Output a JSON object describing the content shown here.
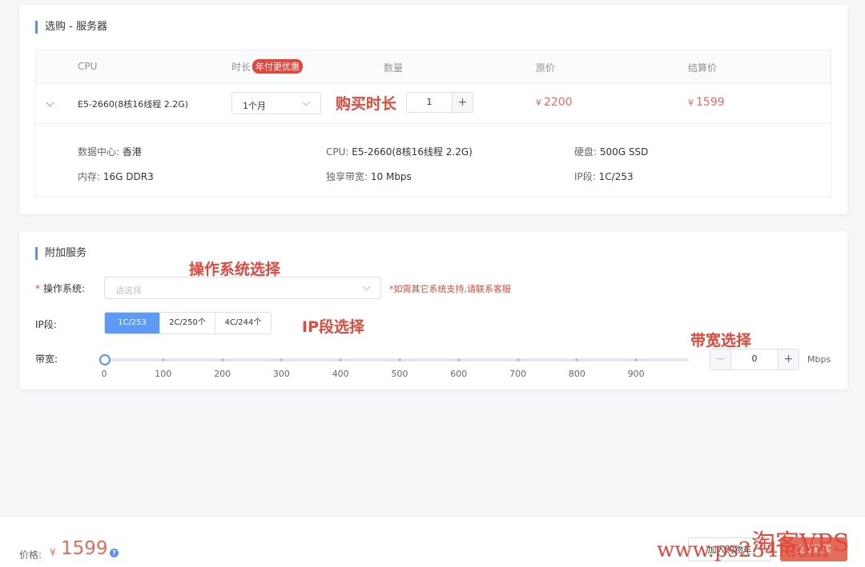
{
  "server": {
    "section_title": "选购 - 服务器",
    "headers": {
      "cpu": "CPU",
      "duration": "时长",
      "duration_badge": "年付更优惠",
      "quantity": "数量",
      "original_price": "原价",
      "final_price": "结算价"
    },
    "row": {
      "cpu": "E5-2660(8核16线程 2.2G)",
      "duration": "1个月",
      "quantity": "1",
      "original_currency": "¥",
      "original_price": "2200",
      "final_currency": "¥",
      "final_price": "1599"
    },
    "details": {
      "datacenter_label": "数据中心:",
      "datacenter": "香港",
      "cpu_label": "CPU:",
      "cpu": "E5-2660(8核16线程 2.2G)",
      "disk_label": "硬盘:",
      "disk": "500G SSD",
      "memory_label": "内存:",
      "memory": "16G DDR3",
      "bandwidth_label": "独享带宽:",
      "bandwidth": "10 Mbps",
      "ip_label": "IP段:",
      "ip": "1C/253"
    }
  },
  "addons": {
    "section_title": "附加服务",
    "os_label": "操作系统:",
    "os_placeholder": "请选择",
    "os_hint": "*如需其它系统支持,请联系客服",
    "ip_label": "IP段:",
    "ip_options": [
      "1C/253",
      "2C/250个",
      "4C/244个"
    ],
    "ip_selected": 0,
    "bandwidth_label": "带宽:",
    "bandwidth_ticks": [
      "0",
      "100",
      "200",
      "300",
      "400",
      "500",
      "600",
      "700",
      "800",
      "900"
    ],
    "bandwidth_value": "0",
    "bandwidth_unit": "Mbps",
    "stepper_minus": "−",
    "stepper_plus": "+"
  },
  "annotations": {
    "duration": "购买时长",
    "os": "操作系统选择",
    "ip": "IP段选择",
    "bandwidth": "带宽选择"
  },
  "footer": {
    "price_label": "价格:",
    "currency": "¥",
    "total": "1599",
    "help": "?",
    "secondary_button": "加入购物车",
    "primary_button": "立即购买"
  },
  "watermark": {
    "line1": "淘客VPS",
    "line2": "www.ps234.com"
  },
  "colors": {
    "accent": "#5b8ff9",
    "price": "#e46c5b",
    "annotation": "#e2483b"
  }
}
